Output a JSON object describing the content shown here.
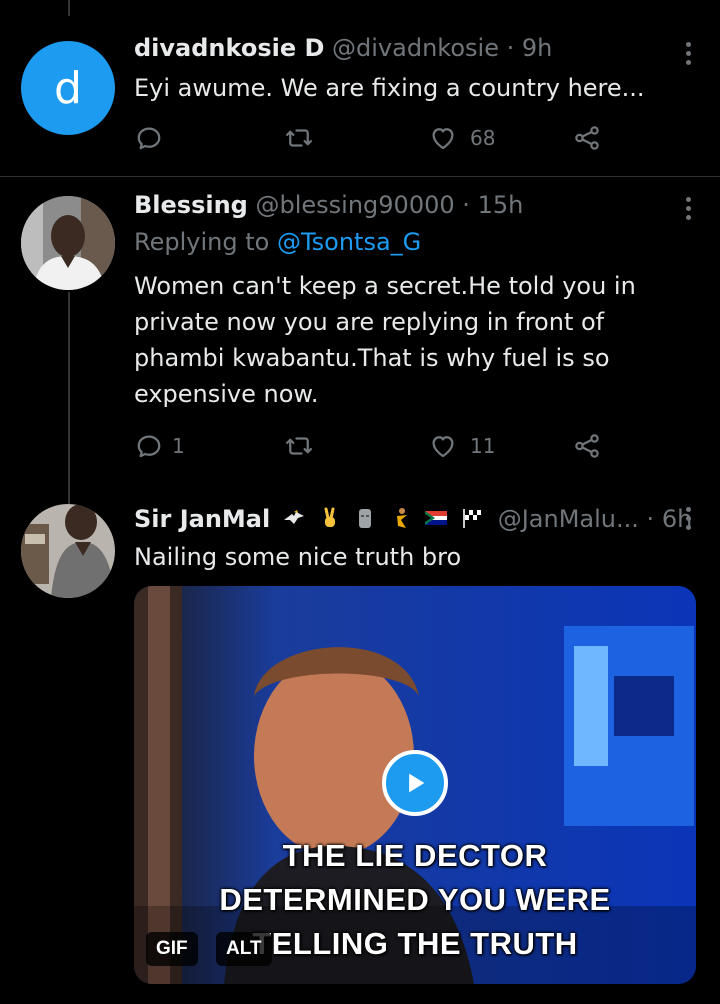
{
  "tweets": [
    {
      "avatar_letter": "d",
      "name": "divadnkosie D",
      "handle": "@divadnkosie",
      "sep": "·",
      "time": "9h",
      "text": "Eyi awume. We are fixing  a country  here...",
      "likes": "68"
    },
    {
      "name": "Blessing",
      "handle": "@blessing90000",
      "sep": "·",
      "time": "15h",
      "replying_prefix": "Replying to",
      "replying_to": "@Tsontsa_G",
      "text_lines": [
        "Women can't keep a secret.He told you in",
        "private now you are replying in front of",
        "phambi kwabantu.That is why fuel is so",
        "expensive now."
      ],
      "replies": "1",
      "likes": "11"
    },
    {
      "name": "Sir JanMal",
      "handle": "@JanMalu...",
      "sep": "·",
      "time": "6h",
      "text": "Nailing some nice truth bro",
      "media": {
        "caption_lines": [
          "THE LIE DECTOR",
          "DETERMINED YOU WERE",
          "TELLING THE TRUTH"
        ],
        "gif_badge": "GIF",
        "alt_badge": "ALT"
      }
    }
  ],
  "colors": {
    "accent": "#1d9bf0",
    "muted": "#71767b",
    "text": "#e7e9ea",
    "background": "#000000"
  }
}
